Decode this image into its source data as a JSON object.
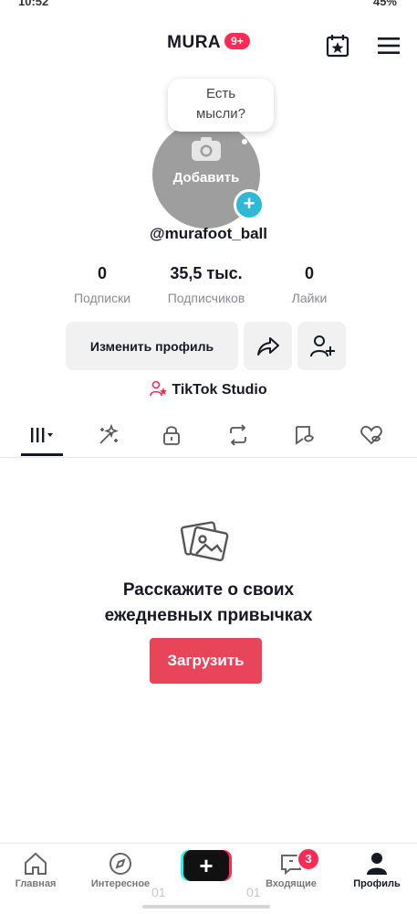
{
  "status_bar": {
    "time": "10:52",
    "battery": "45%"
  },
  "header": {
    "brand": "MURA",
    "badge": "9+"
  },
  "profile": {
    "avatar_label": "Добавить",
    "bubble_text_1": "Есть",
    "bubble_text_2": "мысли?",
    "username": "@murafoot_ball",
    "stats": [
      {
        "value": "0",
        "label": "Подписки"
      },
      {
        "value": "35,5 тыс.",
        "label": "Подписчиков"
      },
      {
        "value": "0",
        "label": "Лайки"
      }
    ],
    "edit_label": "Изменить профиль",
    "studio_label": "TikTok Studio"
  },
  "tabs": [
    "grid-icon",
    "sparkle-icon",
    "lock-icon",
    "repost-icon",
    "saved-icon",
    "liked-icon"
  ],
  "empty_state": {
    "line1": "Расскажите о своих",
    "line2": "ежедневных привычках",
    "button": "Загрузить"
  },
  "bottom_nav": {
    "home": "Главная",
    "explore": "Интересное",
    "inbox": "Входящие",
    "inbox_badge": "3",
    "profile": "Профиль",
    "ghost_left": "01",
    "ghost_right": "01"
  },
  "colors": {
    "accent": "#fe2c55",
    "upload": "#e8445a",
    "plus": "#2fb9d6"
  }
}
